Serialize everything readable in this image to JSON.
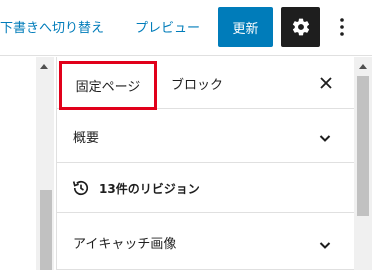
{
  "toolbar": {
    "switch_to_draft": "下書きへ切り替え",
    "preview": "プレビュー",
    "update": "更新",
    "settings_icon": "gear-icon",
    "more_icon": "vertical-ellipsis-icon"
  },
  "sidebar": {
    "tabs": [
      {
        "label": "固定ページ",
        "active": true
      },
      {
        "label": "ブロック",
        "active": false
      }
    ],
    "close_icon": "close-icon",
    "panels": {
      "summary": {
        "title": "概要",
        "expanded": false
      },
      "revisions": {
        "label": "13件のリビジョン",
        "icon": "history-icon"
      },
      "featured_image": {
        "title": "アイキャッチ画像",
        "expanded": false
      }
    }
  },
  "colors": {
    "accent": "#007cba",
    "dark": "#1e1e1e",
    "highlight": "#e1001a",
    "border": "#e0e0e0"
  }
}
